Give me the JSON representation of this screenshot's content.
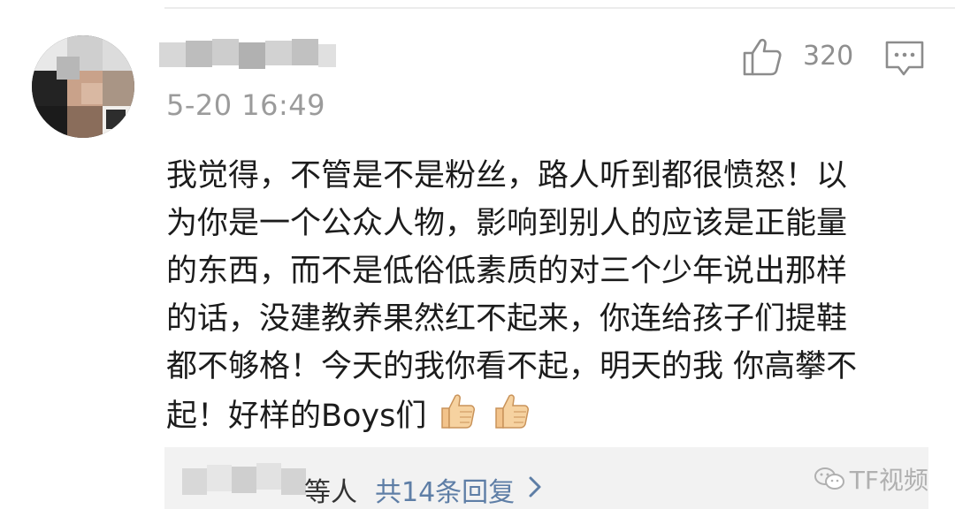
{
  "comment": {
    "timestamp": "5-20 16:49",
    "like_count": "320",
    "lines": [
      "我觉得，不管是不是粉丝，路人听到都很愤怒！以",
      "为你是一个公众人物，影响到别人的应该是正能量",
      "的东西，而不是低俗低素质的对三个少年说出那样",
      "的话，没建教养果然红不起来，你连给孩子们提鞋",
      "都不够格！今天的我你看不起，明天的我 你高攀不",
      "起！好样的Boys们"
    ]
  },
  "replies": {
    "suffix": "等人",
    "link_text": "共14条回复"
  },
  "watermark": {
    "text": "TF视频"
  },
  "icons": {
    "like": "thumbs-up-outline-icon",
    "comment": "comment-bubble-icon",
    "emoji": "thumbs-up-emoji-icon",
    "chevron": "chevron-right-icon",
    "watermark": "wechat-logo-icon"
  },
  "colors": {
    "text": "#1c1c1c",
    "muted": "#9b9b9b",
    "link": "#5e7ea6",
    "reply_bg": "#f2f2f2"
  }
}
